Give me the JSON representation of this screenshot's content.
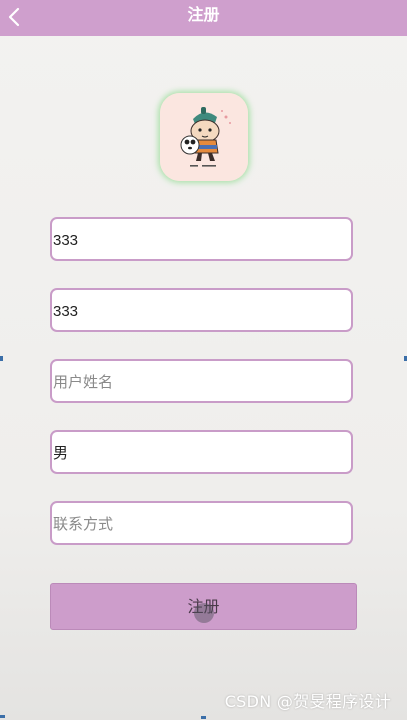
{
  "header": {
    "title": "注册",
    "background": "#cf9fcd",
    "back_icon": "chevron-left-icon"
  },
  "avatar": {
    "icon": "cartoon-panda-avatar-icon",
    "background": "#fbe6e0"
  },
  "form": {
    "fields": [
      {
        "value": "333",
        "placeholder": ""
      },
      {
        "value": "333",
        "placeholder": ""
      },
      {
        "value": "",
        "placeholder": "用户姓名"
      },
      {
        "value": "男",
        "placeholder": ""
      },
      {
        "value": "",
        "placeholder": "联系方式"
      }
    ],
    "border_color": "#c99cc8"
  },
  "register_button": {
    "label": "注册",
    "background": "#cd9dcb"
  },
  "watermark": {
    "text": "CSDN @贺旻程序设计"
  }
}
